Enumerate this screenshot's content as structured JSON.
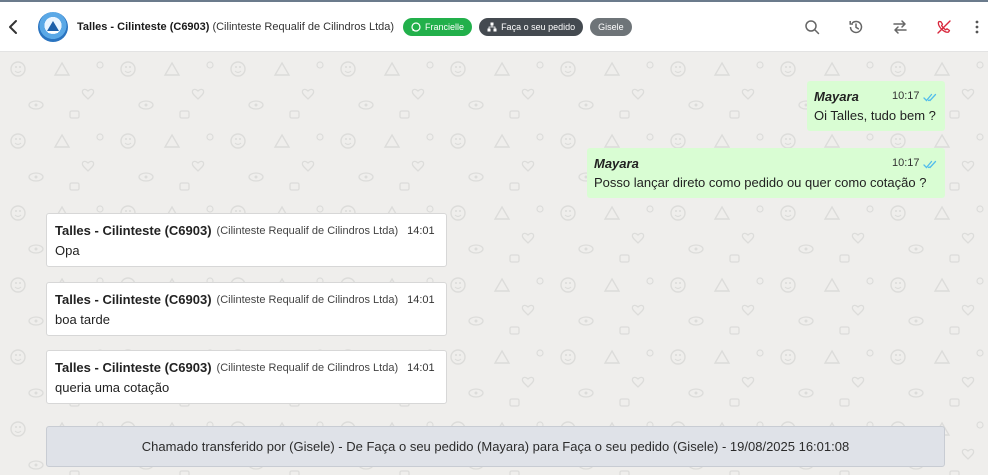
{
  "header": {
    "contact_name": "Talles - Cilinteste (C6903)",
    "company": "(Cilinteste Requalif de Cilindros Ltda)",
    "tags": [
      {
        "label": "Francielle",
        "color": "#22b04b",
        "icon": "whatsapp-icon"
      },
      {
        "label": "Faça o seu pedido",
        "color": "#444a50",
        "icon": "hierarchy-icon"
      },
      {
        "label": "Gisele",
        "color": "#6e7478"
      }
    ],
    "actions": [
      "search-icon",
      "history-icon",
      "transfer-icon",
      "end-call-icon",
      "more-vert-icon"
    ]
  },
  "messages": {
    "outgoing": [
      {
        "sender": "Mayara",
        "time": "10:17",
        "text": "Oi Talles, tudo bem ?"
      },
      {
        "sender": "Mayara",
        "time": "10:17",
        "text": "Posso lançar direto como pedido ou quer como cotação ?"
      }
    ],
    "incoming": [
      {
        "name": "Talles - Cilinteste (C6903)",
        "company": "(Cilinteste Requalif de Cilindros Ltda)",
        "time": "14:01",
        "text": "Opa"
      },
      {
        "name": "Talles - Cilinteste (C6903)",
        "company": "(Cilinteste Requalif de Cilindros Ltda)",
        "time": "14:01",
        "text": "boa tarde"
      },
      {
        "name": "Talles - Cilinteste (C6903)",
        "company": "(Cilinteste Requalif de Cilindros Ltda)",
        "time": "14:01",
        "text": "queria uma cotação"
      }
    ]
  },
  "system_notice": "Chamado transferido por (Gisele) - De Faça o seu pedido (Mayara) para Faça o seu pedido (Gisele) - 19/08/2025 16:01:08",
  "colors": {
    "outgoing_bubble": "#d9fdd3",
    "incoming_bubble": "#ffffff",
    "background": "#efeeec",
    "read_check": "#53bdeb",
    "end_call": "#d8263b"
  }
}
